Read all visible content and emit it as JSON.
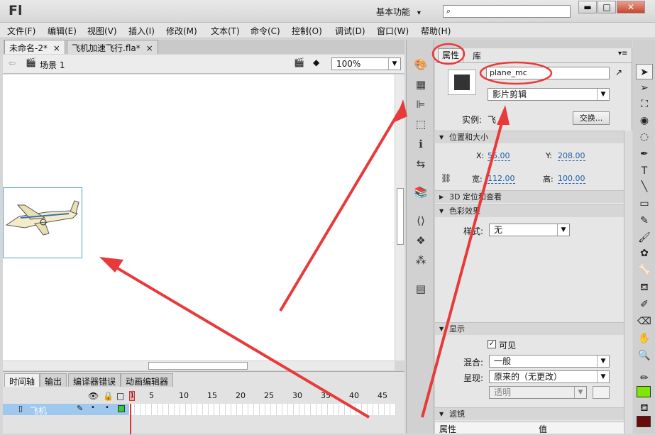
{
  "app": {
    "logo": "Fl",
    "workspace": "基本功能",
    "workspace_arrow": "▾"
  },
  "window": {
    "minimize": "▬",
    "maximize": "□",
    "close": "✕"
  },
  "menu": [
    "文件(F)",
    "编辑(E)",
    "视图(V)",
    "插入(I)",
    "修改(M)",
    "文本(T)",
    "命令(C)",
    "控制(O)",
    "调试(D)",
    "窗口(W)",
    "帮助(H)"
  ],
  "doc_tabs": [
    {
      "label": "未命名-2*",
      "close": "×"
    },
    {
      "label": "飞机加速飞行.fla*",
      "close": "×"
    }
  ],
  "scene": {
    "back_icon": "back-arrow-icon",
    "label": "场景 1",
    "zoom": "100%"
  },
  "timeline": {
    "tabs": [
      "时间轴",
      "输出",
      "编译器错误",
      "动画编辑器"
    ],
    "frame_numbers": [
      "1",
      "5",
      "10",
      "15",
      "20",
      "25",
      "30",
      "35",
      "40",
      "45"
    ],
    "layer_name": "飞机"
  },
  "properties": {
    "tabs": [
      "属性",
      "库"
    ],
    "instance_name": "plane_mc",
    "instance_type": "影片剪辑",
    "instance_label": "实例:",
    "instance_of": "飞",
    "swap_button": "交换...",
    "position_section": "位置和大小",
    "x_label": "X:",
    "x_value": "55.00",
    "y_label": "Y:",
    "y_value": "208.00",
    "w_label": "宽:",
    "w_value": "112.00",
    "h_label": "高:",
    "h_value": "100.00",
    "section_3d": "3D 定位和查看",
    "color_section": "色彩效果",
    "style_label": "样式:",
    "style_value": "无",
    "display_section": "显示",
    "visible_label": "可见",
    "blend_label": "混合:",
    "blend_value": "一般",
    "render_label": "呈现:",
    "render_value": "原来的（无更改）",
    "transparent_value": "透明",
    "filter_section": "滤镜",
    "filter_col_prop": "属性",
    "filter_col_val": "值"
  },
  "colors": {
    "accent_red": "#e83a3a",
    "fill_green": "#7fe800",
    "fill_dark_red": "#6a0a0a",
    "selection_blue": "#1f5fa8"
  }
}
